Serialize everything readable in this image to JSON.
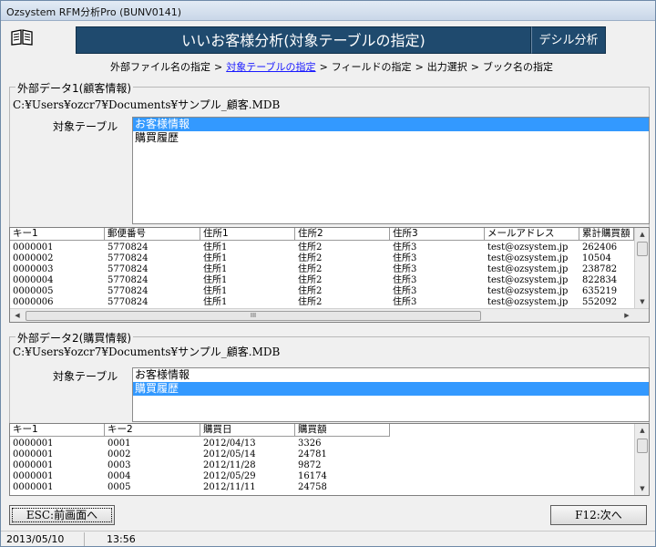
{
  "window": {
    "title": "Ozsystem RFM分析Pro (BUNV0141)"
  },
  "header": {
    "title": "いいお客様分析(対象テーブルの指定)",
    "side_label": "デシル分析"
  },
  "icons": {
    "header_icon": "book-icon"
  },
  "breadcrumb": [
    {
      "label": "外部ファイル名の指定",
      "active": false
    },
    {
      "label": "対象テーブルの指定",
      "active": true
    },
    {
      "label": "フィールドの指定",
      "active": false
    },
    {
      "label": "出力選択",
      "active": false
    },
    {
      "label": "ブック名の指定",
      "active": false
    }
  ],
  "breadcrumb_sep": ">",
  "group1": {
    "legend": "外部データ1(顧客情報)",
    "path": "C:¥Users¥ozcr7¥Documents¥サンプル_顧客.MDB",
    "table_label": "対象テーブル",
    "options": [
      "お客様情報",
      "購買履歴"
    ],
    "selected_index": 0
  },
  "grid1": {
    "columns": [
      "キー1",
      "郵便番号",
      "住所1",
      "住所2",
      "住所3",
      "メールアドレス",
      "累計購買額"
    ],
    "rows": [
      [
        "0000001",
        "5770824",
        "住所1",
        "住所2",
        "住所3",
        "test@ozsystem.jp",
        "262406"
      ],
      [
        "0000002",
        "5770824",
        "住所1",
        "住所2",
        "住所3",
        "test@ozsystem.jp",
        "10504"
      ],
      [
        "0000003",
        "5770824",
        "住所1",
        "住所2",
        "住所3",
        "test@ozsystem.jp",
        "238782"
      ],
      [
        "0000004",
        "5770824",
        "住所1",
        "住所2",
        "住所3",
        "test@ozsystem.jp",
        "822834"
      ],
      [
        "0000005",
        "5770824",
        "住所1",
        "住所2",
        "住所3",
        "test@ozsystem.jp",
        "635219"
      ],
      [
        "0000006",
        "5770824",
        "住所1",
        "住所2",
        "住所3",
        "test@ozsystem.jp",
        "552092"
      ]
    ],
    "hscroll_grip": "III"
  },
  "group2": {
    "legend": "外部データ2(購買情報)",
    "path": "C:¥Users¥ozcr7¥Documents¥サンプル_顧客.MDB",
    "table_label": "対象テーブル",
    "options": [
      "お客様情報",
      "購買履歴"
    ],
    "selected_index": 1
  },
  "grid2": {
    "columns": [
      "キー1",
      "キー2",
      "購買日",
      "購買額"
    ],
    "rows": [
      [
        "0000001",
        "0001",
        "2012/04/13",
        "3326"
      ],
      [
        "0000001",
        "0002",
        "2012/05/14",
        "24781"
      ],
      [
        "0000001",
        "0003",
        "2012/11/28",
        "9872"
      ],
      [
        "0000001",
        "0004",
        "2012/05/29",
        "16174"
      ],
      [
        "0000001",
        "0005",
        "2012/11/11",
        "24758"
      ]
    ]
  },
  "buttons": {
    "back": "ESC:前画面へ",
    "next": "F12:次へ"
  },
  "status": {
    "date": "2013/05/10",
    "time": "13:56"
  }
}
